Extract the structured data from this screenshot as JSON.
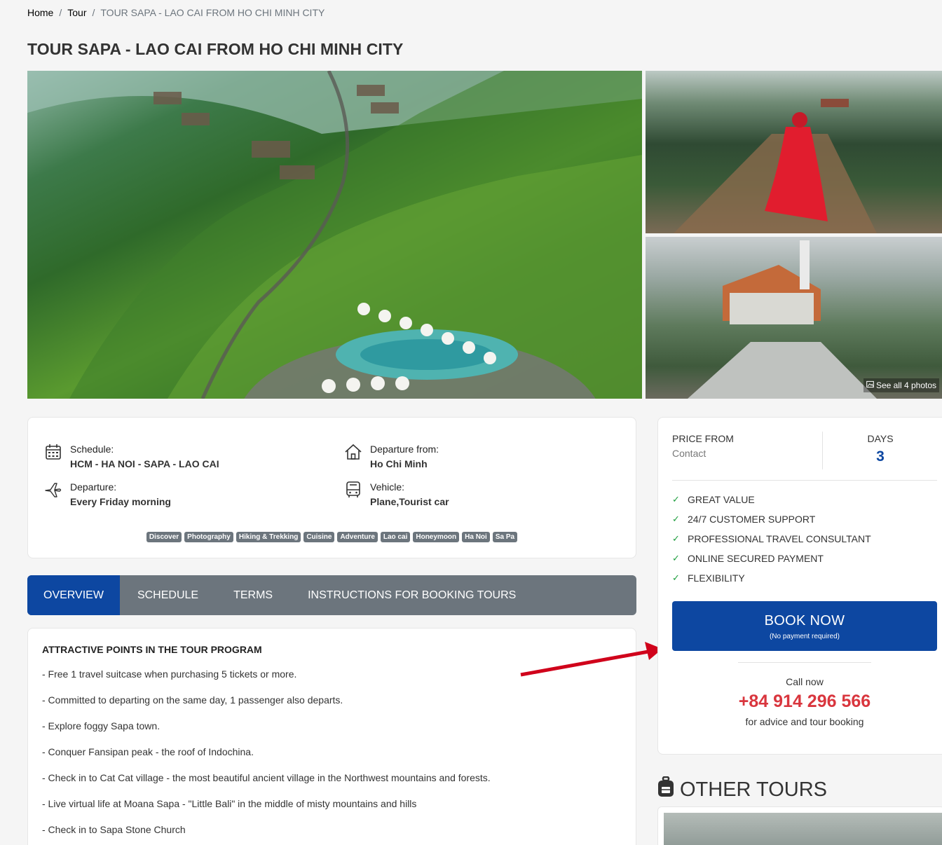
{
  "breadcrumb": {
    "home": "Home",
    "tour": "Tour",
    "current": "TOUR SAPA - LAO CAI FROM HO CHI MINH CITY"
  },
  "title": "TOUR SAPA - LAO CAI FROM HO CHI MINH CITY",
  "gallery": {
    "see_all": "See all 4 photos"
  },
  "info": {
    "schedule_label": "Schedule:",
    "schedule_value": "HCM - HA NOI - SAPA - LAO CAI",
    "departure_from_label": "Departure from:",
    "departure_from_value": "Ho Chi Minh",
    "departure_label": "Departure:",
    "departure_value": "Every Friday morning",
    "vehicle_label": "Vehicle:",
    "vehicle_value": "Plane,Tourist car"
  },
  "tags": [
    "Discover",
    "Photography",
    "Hiking & Trekking",
    "Cuisine",
    "Adventure",
    "Lao cai",
    "Honeymoon",
    "Ha Noi",
    "Sa Pa"
  ],
  "tabs": [
    {
      "label": "OVERVIEW",
      "active": true
    },
    {
      "label": "SCHEDULE",
      "active": false
    },
    {
      "label": "TERMS",
      "active": false
    },
    {
      "label": "INSTRUCTIONS FOR BOOKING TOURS",
      "active": false
    }
  ],
  "overview": {
    "heading": "ATTRACTIVE POINTS IN THE TOUR PROGRAM",
    "points": [
      "- Free 1 travel suitcase when purchasing 5 tickets or more.",
      "- Committed to departing on the same day, 1 passenger also departs.",
      "- Explore foggy Sapa town.",
      "- Conquer Fansipan peak - the roof of Indochina.",
      "- Check in to Cat Cat village - the most beautiful ancient village in the Northwest mountains and forests.",
      "- Live virtual life at Moana Sapa - \"Little Bali\" in the middle of misty mountains and hills",
      "- Check in to Sapa Stone Church"
    ]
  },
  "booking": {
    "price_label": "PRICE FROM",
    "price_value": "Contact",
    "days_label": "DAYS",
    "days_value": "3",
    "features": [
      "GREAT VALUE",
      "24/7 CUSTOMER SUPPORT",
      "PROFESSIONAL TRAVEL CONSULTANT",
      "ONLINE SECURED PAYMENT",
      "FLEXIBILITY"
    ],
    "book_label": "BOOK NOW",
    "book_sub": "(No payment required)",
    "call_label": "Call now",
    "phone": "+84 914 296 566",
    "call_sub": "for advice and tour booking"
  },
  "other_tours": {
    "title": "OTHER TOURS"
  },
  "colors": {
    "primary": "#0d47a1",
    "tab_bg": "#6c757d",
    "phone": "#d9363e",
    "check": "#1e9e3e",
    "arrow": "#d0021b"
  }
}
